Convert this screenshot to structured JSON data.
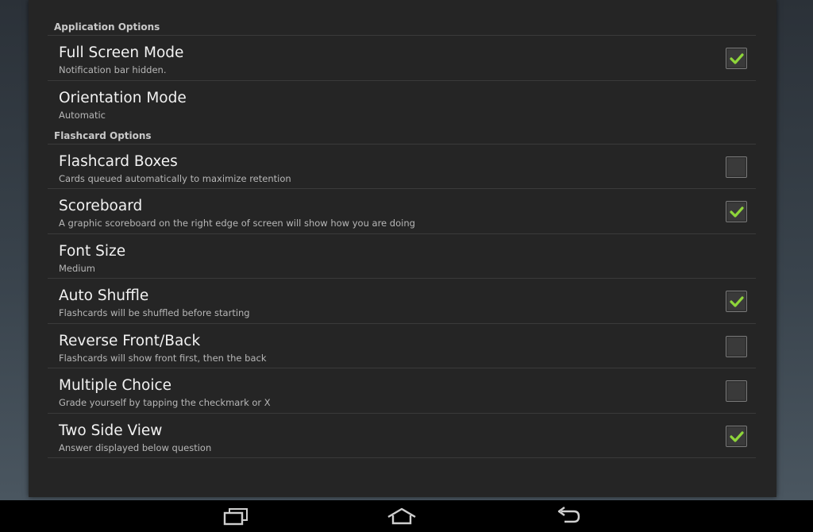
{
  "sections": [
    {
      "header": "Application Options",
      "items": [
        {
          "title": "Full Screen Mode",
          "summary": "Notification bar hidden.",
          "has_checkbox": true,
          "checked": true
        },
        {
          "title": "Orientation Mode",
          "summary": "Automatic",
          "has_checkbox": false,
          "checked": false
        }
      ]
    },
    {
      "header": "Flashcard Options",
      "items": [
        {
          "title": "Flashcard Boxes",
          "summary": "Cards queued automatically to maximize retention",
          "has_checkbox": true,
          "checked": false
        },
        {
          "title": "Scoreboard",
          "summary": "A graphic scoreboard on the right edge of screen will show how you are doing",
          "has_checkbox": true,
          "checked": true
        },
        {
          "title": "Font Size",
          "summary": "Medium",
          "has_checkbox": false,
          "checked": false
        },
        {
          "title": "Auto Shuffle",
          "summary": "Flashcards will be shuffled before starting",
          "has_checkbox": true,
          "checked": true
        },
        {
          "title": "Reverse Front/Back",
          "summary": "Flashcards will show front first, then the back",
          "has_checkbox": true,
          "checked": false
        },
        {
          "title": "Multiple Choice",
          "summary": "Grade yourself by tapping the checkmark or X",
          "has_checkbox": true,
          "checked": false
        },
        {
          "title": "Two Side View",
          "summary": "Answer displayed below question",
          "has_checkbox": true,
          "checked": true
        }
      ]
    }
  ],
  "navbar": {
    "buttons": [
      "recent-apps-icon",
      "home-icon",
      "back-icon"
    ]
  },
  "colors": {
    "check": "#8fd63a",
    "background": "#252525",
    "divider": "#3a3a3a"
  }
}
